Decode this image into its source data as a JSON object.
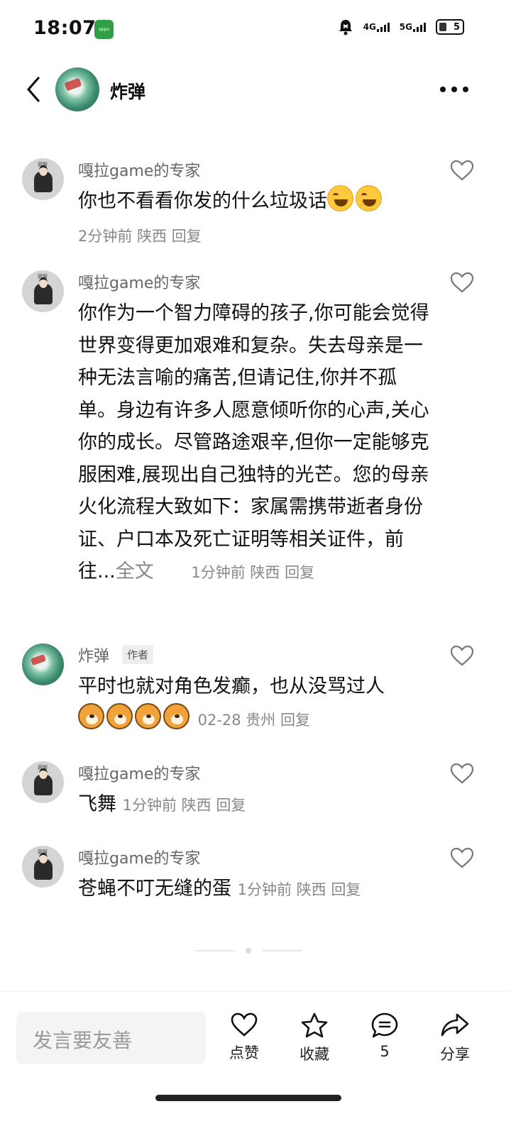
{
  "status_bar": {
    "time": "18:07",
    "app_badge": "oppo",
    "network_1": "4G",
    "network_2": "5G",
    "battery": "5"
  },
  "header": {
    "title": "炸弹"
  },
  "comments": [
    {
      "author": "嘎拉game的专家",
      "text": "你也不看看你发的什么垃圾话",
      "emojis": [
        "laugh",
        "laugh"
      ],
      "time": "2分钟前",
      "location": "陕西",
      "reply": "回复"
    },
    {
      "author": "嘎拉game的专家",
      "text": "你作为一个智力障碍的孩子,你可能会觉得世界变得更加艰难和复杂。失去母亲是一种无法言喻的痛苦,但请记住,你并不孤单。身边有许多人愿意倾听你的心声,关心你的成长。尽管路途艰辛,但你一定能够克服困难,展现出自己独特的光芒。您的母亲火化流程大致如下：家属需携带逝者身份证、户口本及死亡证明等相关证件，前往...",
      "full_text": "全文",
      "time": "1分钟前",
      "location": "陕西",
      "reply": "回复"
    },
    {
      "author": "炸弹",
      "author_tag": "作者",
      "text": "平时也就对角色发癫，也从没骂过人",
      "emojis": [
        "dog",
        "dog",
        "dog",
        "dog"
      ],
      "time": "02-28",
      "location": "贵州",
      "reply": "回复"
    },
    {
      "author": "嘎拉game的专家",
      "text": "飞舞",
      "time": "1分钟前",
      "location": "陕西",
      "reply": "回复"
    },
    {
      "author": "嘎拉game的专家",
      "text": "苍蝇不叮无缝的蛋",
      "time": "1分钟前",
      "location": "陕西",
      "reply": "回复"
    }
  ],
  "bottom_bar": {
    "input_placeholder": "发言要友善",
    "like_label": "点赞",
    "favorite_label": "收藏",
    "comment_count": "5",
    "share_label": "分享"
  }
}
